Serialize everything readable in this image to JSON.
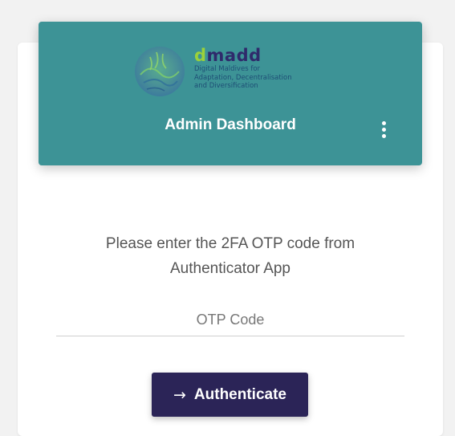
{
  "logo": {
    "brand_prefix": "d",
    "brand_rest": "madd",
    "tagline_lines": [
      "Digital Maldives for",
      "Adaptation, Decentralisation",
      "and Diversification"
    ]
  },
  "header": {
    "title": "Admin Dashboard",
    "menu_icon": "kebab-menu-icon"
  },
  "form": {
    "instruction_line1": "Please enter the 2FA OTP code from",
    "instruction_line2": "Authenticator App",
    "otp_placeholder": "OTP Code",
    "otp_value": ""
  },
  "actions": {
    "authenticate_icon": "→",
    "authenticate_label": "Authenticate"
  },
  "colors": {
    "header_bg": "#3d9396",
    "button_bg": "#2b2457",
    "brand_accent": "#9bd13a",
    "brand_primary": "#2f2a6b"
  }
}
